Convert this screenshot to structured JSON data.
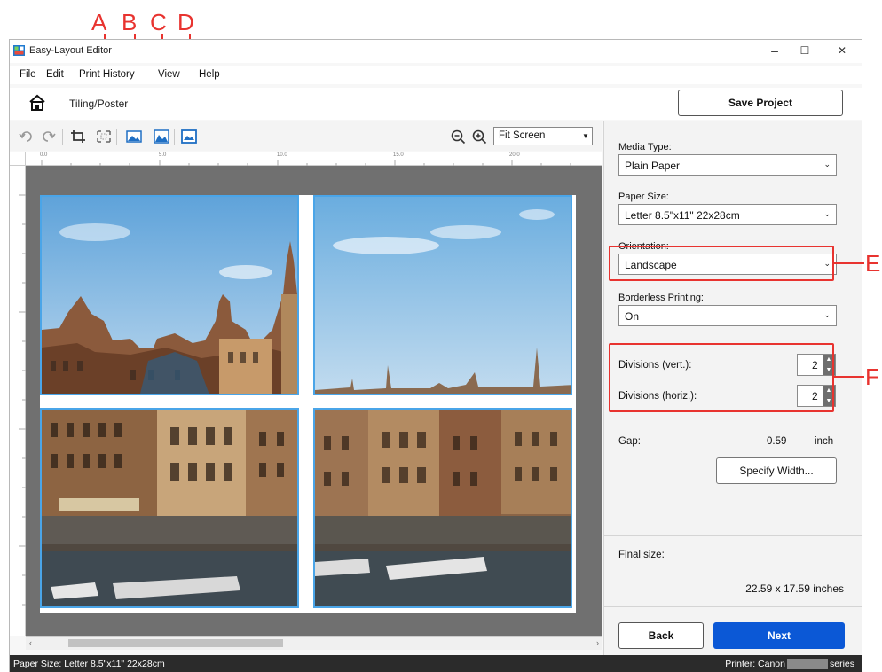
{
  "annotations": {
    "A": "A",
    "B": "B",
    "C": "C",
    "D": "D",
    "E": "E",
    "F": "F",
    "color": "#e8332f"
  },
  "window": {
    "title": "Easy-Layout Editor",
    "controls": {
      "minimize": "–",
      "maximize": "☐",
      "close": "✕"
    }
  },
  "menu": [
    "File",
    "Edit",
    "Print History",
    "View",
    "Help"
  ],
  "nav": {
    "breadcrumb": "Tiling/Poster",
    "save_label": "Save Project"
  },
  "toolbar": {
    "zoom_value": "Fit Screen",
    "icons": [
      "undo-icon",
      "redo-icon",
      "crop-icon",
      "fit-frame-icon",
      "image-icon-a",
      "image-icon-b",
      "image-icon-c",
      "zoom-out-icon",
      "zoom-in-icon"
    ]
  },
  "ruler": {
    "h_labels": [
      "0.0",
      "5.0",
      "10.0",
      "15.0",
      "20.0"
    ]
  },
  "panel": {
    "media_type_label": "Media Type:",
    "media_type_value": "Plain Paper",
    "paper_size_label": "Paper Size:",
    "paper_size_value": "Letter 8.5\"x11\" 22x28cm",
    "orientation_label": "Orientation:",
    "orientation_value": "Landscape",
    "borderless_label": "Borderless Printing:",
    "borderless_value": "On",
    "div_vert_label": "Divisions (vert.):",
    "div_vert_value": "2",
    "div_horiz_label": "Divisions (horiz.):",
    "div_horiz_value": "2",
    "gap_label": "Gap:",
    "gap_value": "0.59",
    "gap_unit": "inch",
    "specify_label": "Specify Width...",
    "final_size_label": "Final size:",
    "final_size_value": "22.59 x 17.59 inches",
    "back_label": "Back",
    "next_label": "Next"
  },
  "status": {
    "paper_size": "Paper Size: Letter 8.5\"x11\" 22x28cm",
    "printer_prefix": "Printer: Canon",
    "printer_suffix": "series"
  },
  "colors": {
    "accent": "#0b58d6",
    "tile_border": "#4aa5e8",
    "status_bg": "#2b2b2b"
  }
}
